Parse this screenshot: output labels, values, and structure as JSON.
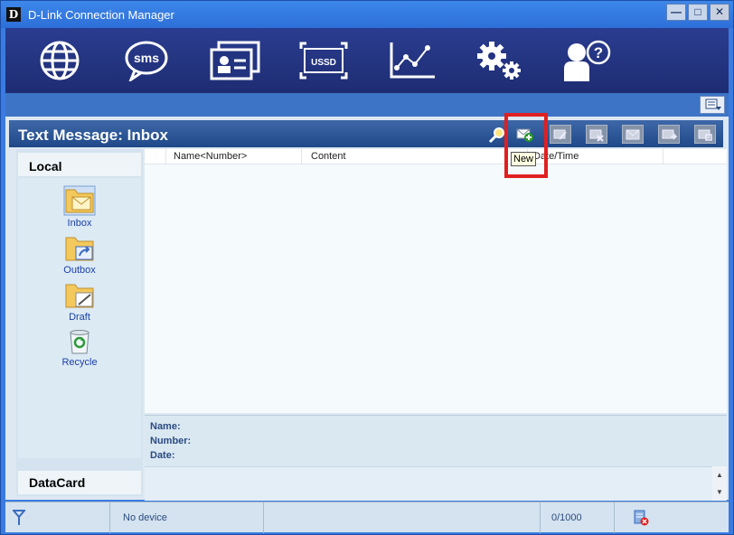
{
  "window": {
    "logo_letter": "D",
    "title": "D-Link Connection Manager",
    "min_label": "—",
    "max_label": "□",
    "close_label": "✕"
  },
  "toolbar": {
    "sms_label": "sms",
    "ussd_label": "USSD"
  },
  "page": {
    "title": "Text Message: Inbox"
  },
  "tooltip": "New",
  "columns": [
    "Name<Number>",
    "Content",
    "Date/Time"
  ],
  "folders": [
    {
      "label": "Inbox"
    },
    {
      "label": "Outbox"
    },
    {
      "label": "Draft"
    },
    {
      "label": "Recycle"
    }
  ],
  "sidebar": {
    "local_label": "Local",
    "datacard_label": "DataCard"
  },
  "detail": {
    "name_label": "Name:",
    "number_label": "Number:",
    "date_label": "Date:"
  },
  "status": {
    "device": "No device",
    "count": "0/1000"
  },
  "colors": {
    "toolbar_bg": "#1e2c73",
    "header_bg": "#1e4888",
    "highlight": "#e02020",
    "link": "#1a3fa8"
  }
}
